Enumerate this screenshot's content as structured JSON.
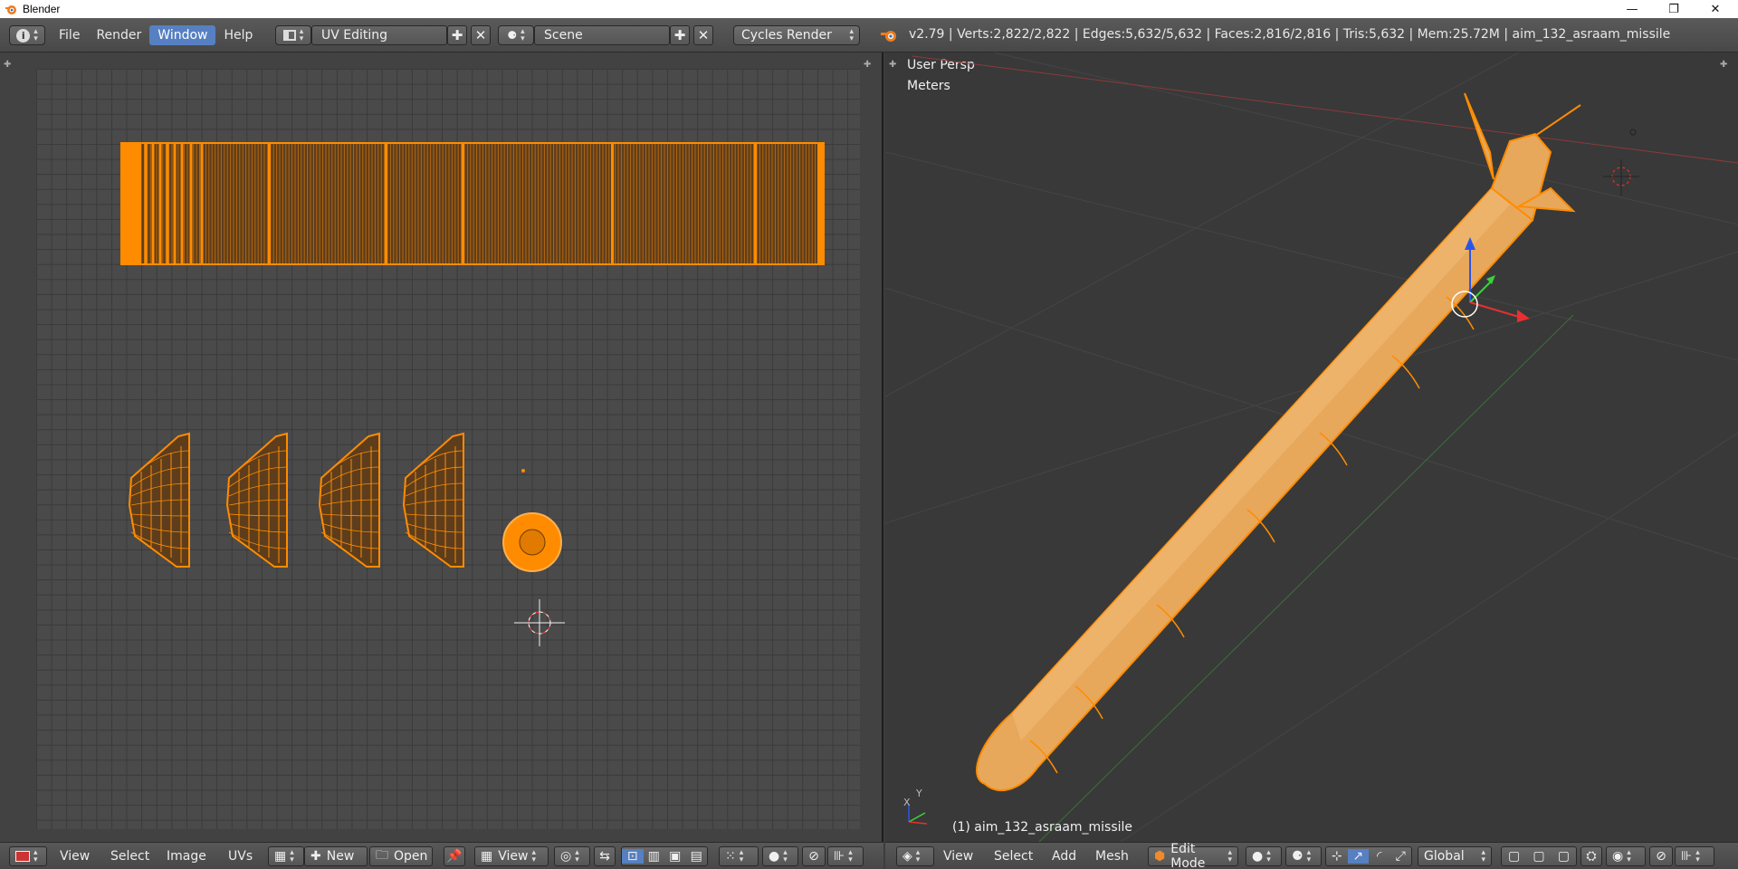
{
  "window": {
    "title": "Blender",
    "controls": {
      "minimize": "—",
      "restore": "❐",
      "close": "✕"
    }
  },
  "topbar": {
    "menus": [
      "File",
      "Render",
      "Window",
      "Help"
    ],
    "active_menu": "Window",
    "screen_layout": "UV Editing",
    "scene": "Scene",
    "engine": "Cycles Render",
    "stats": "v2.79 | Verts:2,822/2,822 | Edges:5,632/5,632 | Faces:2,816/2,816 | Tris:5,632 | Mem:25.72M | aim_132_asraam_missile"
  },
  "view3d": {
    "perspective": "User Persp",
    "units": "Meters",
    "object_label": "(1) aim_132_asraam_missile",
    "axis_x": "X",
    "axis_y": "Y"
  },
  "uv_footer": {
    "menus": [
      "View",
      "Select",
      "Image",
      "UVs"
    ],
    "new_label": "New",
    "open_label": "Open",
    "view_label": "View"
  },
  "v3d_footer": {
    "menus": [
      "View",
      "Select",
      "Add",
      "Mesh"
    ],
    "mode": "Edit Mode",
    "orientation": "Global"
  },
  "colors": {
    "selection": "#ff8c00",
    "accent": "#5680c2",
    "background": "#393939"
  }
}
